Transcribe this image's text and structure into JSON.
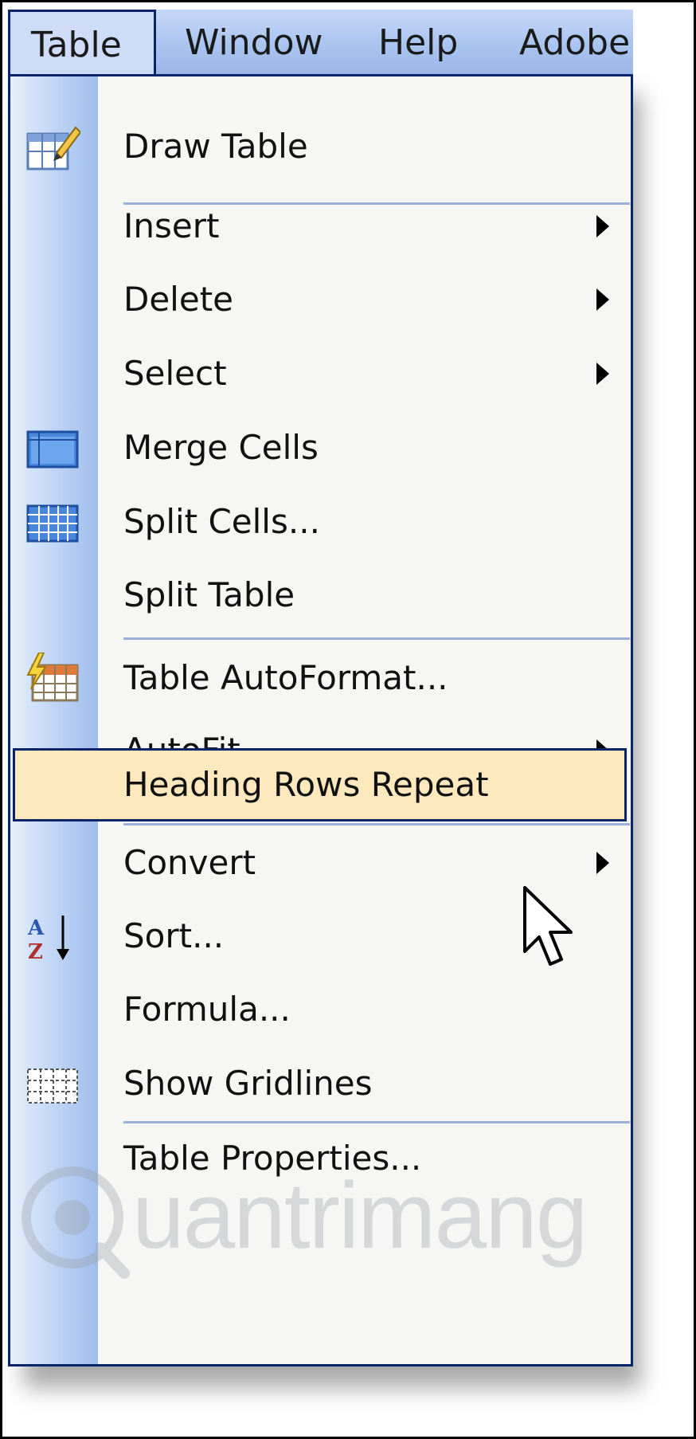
{
  "menubar": {
    "items": [
      {
        "label": "Table"
      },
      {
        "label": "Window"
      },
      {
        "label": "Help"
      },
      {
        "label": "Adobe"
      }
    ]
  },
  "menu": {
    "items": [
      {
        "label": "Draw Table",
        "icon": "draw-table-icon"
      },
      {
        "label": "Insert",
        "submenu": true
      },
      {
        "label": "Delete",
        "submenu": true
      },
      {
        "label": "Select",
        "submenu": true
      },
      {
        "label": "Merge Cells",
        "icon": "merge-cells-icon"
      },
      {
        "label": "Split Cells...",
        "icon": "split-cells-icon"
      },
      {
        "label": "Split Table"
      },
      {
        "label": "Table AutoFormat...",
        "icon": "autoformat-icon"
      },
      {
        "label": "AutoFit",
        "submenu": true
      },
      {
        "label": "Heading Rows Repeat",
        "highlighted": true
      },
      {
        "label": "Convert",
        "submenu": true
      },
      {
        "label": "Sort...",
        "icon": "sort-az-icon"
      },
      {
        "label": "Formula..."
      },
      {
        "label": "Show Gridlines",
        "icon": "gridlines-icon"
      },
      {
        "label": "Table Properties..."
      }
    ]
  },
  "colors": {
    "accent_border": "#0a246a",
    "highlight": "#fde9bd",
    "menu_bg": "#f6f6f5",
    "menubar_bg": "#a9c3ef"
  },
  "watermark": {
    "text": "uantrimang"
  }
}
